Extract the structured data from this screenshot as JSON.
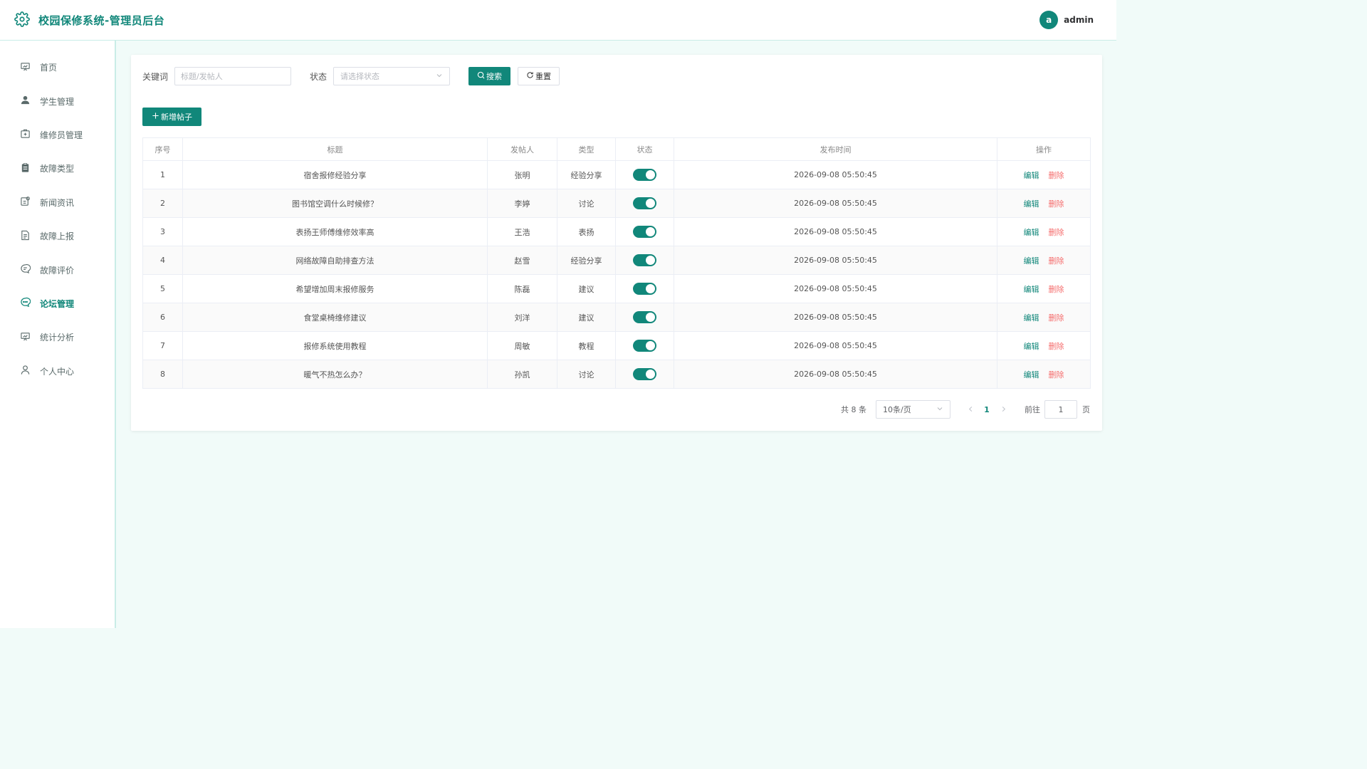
{
  "header": {
    "title": "校园保修系统-管理员后台",
    "avatar_letter": "a",
    "username": "admin"
  },
  "sidebar": {
    "items": [
      {
        "label": "首页",
        "icon": "home-icon"
      },
      {
        "label": "学生管理",
        "icon": "user-icon"
      },
      {
        "label": "维修员管理",
        "icon": "toolbox-icon"
      },
      {
        "label": "故障类型",
        "icon": "clipboard-icon"
      },
      {
        "label": "新闻资讯",
        "icon": "news-icon"
      },
      {
        "label": "故障上报",
        "icon": "report-icon"
      },
      {
        "label": "故障评价",
        "icon": "comment-icon"
      },
      {
        "label": "论坛管理",
        "icon": "chat-icon",
        "active": true
      },
      {
        "label": "统计分析",
        "icon": "chart-icon"
      },
      {
        "label": "个人中心",
        "icon": "person-icon"
      }
    ]
  },
  "search": {
    "keyword_label": "关键词",
    "keyword_placeholder": "标题/发帖人",
    "keyword_value": "",
    "status_label": "状态",
    "status_placeholder": "请选择状态",
    "search_label": "搜索",
    "reset_label": "重置"
  },
  "toolbar": {
    "add_label": "新增帖子"
  },
  "table": {
    "headers": [
      "序号",
      "标题",
      "发帖人",
      "类型",
      "状态",
      "发布时间",
      "操作"
    ],
    "rows": [
      {
        "no": "1",
        "title": "宿舍报修经验分享",
        "author": "张明",
        "type": "经验分享",
        "status": true,
        "time": "2026-09-08 05:50:45"
      },
      {
        "no": "2",
        "title": "图书馆空调什么时候修？",
        "author": "李婷",
        "type": "讨论",
        "status": true,
        "time": "2026-09-08 05:50:45"
      },
      {
        "no": "3",
        "title": "表扬王师傅维修效率高",
        "author": "王浩",
        "type": "表扬",
        "status": true,
        "time": "2026-09-08 05:50:45"
      },
      {
        "no": "4",
        "title": "网络故障自助排查方法",
        "author": "赵雪",
        "type": "经验分享",
        "status": true,
        "time": "2026-09-08 05:50:45"
      },
      {
        "no": "5",
        "title": "希望增加周末报修服务",
        "author": "陈磊",
        "type": "建议",
        "status": true,
        "time": "2026-09-08 05:50:45"
      },
      {
        "no": "6",
        "title": "食堂桌椅维修建议",
        "author": "刘洋",
        "type": "建议",
        "status": true,
        "time": "2026-09-08 05:50:45"
      },
      {
        "no": "7",
        "title": "报修系统使用教程",
        "author": "周敏",
        "type": "教程",
        "status": true,
        "time": "2026-09-08 05:50:45"
      },
      {
        "no": "8",
        "title": "暖气不热怎么办？",
        "author": "孙凯",
        "type": "讨论",
        "status": true,
        "time": "2026-09-08 05:50:45"
      }
    ],
    "edit_label": "编辑",
    "delete_label": "删除"
  },
  "pagination": {
    "total_text": "共 8 条",
    "page_size": "10条/页",
    "current_page": "1",
    "goto_label": "前往",
    "goto_value": "1",
    "page_suffix": "页"
  },
  "colors": {
    "primary": "#11877a",
    "danger": "#f56c6c",
    "background": "#f1fbf9"
  }
}
